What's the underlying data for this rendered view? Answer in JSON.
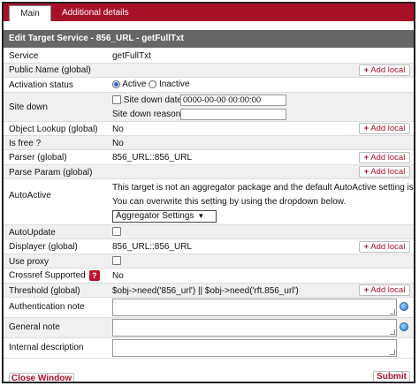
{
  "tabs": [
    {
      "label": "Main"
    },
    {
      "label": "Additional details"
    }
  ],
  "title": "Edit Target Service - 856_URL - getFullTxt",
  "add_local_label": "Add local",
  "rows": {
    "service": {
      "label": "Service",
      "value": "getFullTxt"
    },
    "public_name": {
      "label": "Public Name (global)"
    },
    "activation": {
      "label": "Activation status",
      "option_active": "Active",
      "option_inactive": "Inactive",
      "selected": "Active"
    },
    "site_down": {
      "label": "Site down",
      "date_label": "Site down date",
      "date_value": "0000-00-00 00:00:00",
      "reason_label": "Site down reason",
      "reason_value": ""
    },
    "object_lookup": {
      "label": "Object Lookup (global)",
      "value": "No"
    },
    "is_free": {
      "label": "Is free ?",
      "value": "No"
    },
    "parser": {
      "label": "Parser (global)",
      "value": "856_URL::856_URL"
    },
    "parse_param": {
      "label": "Parse Param (global)"
    },
    "autoactive": {
      "label": "AutoActive",
      "text_line1": "This target is not an aggregator package and the default AutoActive setting is 'No'",
      "text_line2": "You can overwrite this setting by using the dropdown below.",
      "select_value": "Aggregator Settings"
    },
    "autoupdate": {
      "label": "AutoUpdate"
    },
    "displayer": {
      "label": "Displayer (global)",
      "value": "856_URL::856_URL"
    },
    "use_proxy": {
      "label": "Use proxy"
    },
    "crossref": {
      "label": "Crossref Supported",
      "help": "?",
      "value": "No"
    },
    "threshold": {
      "label": "Threshold (global)",
      "value": "$obj->need('856_url') || $obj->need('rft.856_url')"
    },
    "auth_note": {
      "label": "Authentication note"
    },
    "general_note": {
      "label": "General note"
    },
    "internal_desc": {
      "label": "Internal description"
    }
  },
  "footer": {
    "close_label": "Close Window",
    "submit_label": "Submit"
  },
  "colors": {
    "brand": "#a8102a",
    "title_bg": "#666666",
    "alt_row": "#f0f0f0"
  }
}
